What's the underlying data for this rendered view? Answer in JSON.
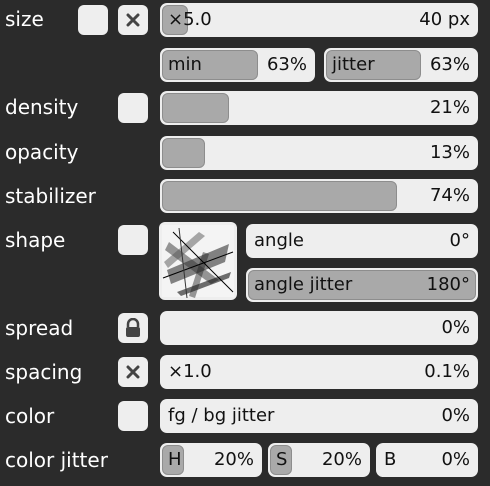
{
  "rows": {
    "size": {
      "label": "size",
      "multiplier": "×5.0",
      "value": "40 px",
      "fill_fraction": 0.07,
      "min": {
        "label": "min",
        "value": "63%",
        "fill_fraction": 0.63
      },
      "jitter": {
        "label": "jitter",
        "value": "63%",
        "fill_fraction": 0.63
      }
    },
    "density": {
      "label": "density",
      "value": "21%",
      "fill_fraction": 0.21
    },
    "opacity": {
      "label": "opacity",
      "value": "13%",
      "fill_fraction": 0.13
    },
    "stabilizer": {
      "label": "stabilizer",
      "value": "74%",
      "fill_fraction": 0.74
    },
    "shape": {
      "label": "shape",
      "angle": {
        "label": "angle",
        "value": "0°",
        "fill_fraction": 0.0
      },
      "angle_jitter": {
        "label": "angle jitter",
        "value": "180°",
        "fill_fraction": 1.0
      }
    },
    "spread": {
      "label": "spread",
      "value": "0%",
      "fill_fraction": 0.0,
      "icon": "lock-icon"
    },
    "spacing": {
      "label": "spacing",
      "multiplier": "×1.0",
      "value": "0.1%",
      "fill_fraction": 0.0,
      "icon": "close-icon"
    },
    "color": {
      "label": "color",
      "field_label": "fg / bg jitter",
      "value": "0%",
      "fill_fraction": 0.0
    },
    "color_jitter": {
      "label": "color jitter",
      "h": {
        "label": "H",
        "value": "20%",
        "fill_fraction": 0.2
      },
      "s": {
        "label": "S",
        "value": "20%",
        "fill_fraction": 0.2
      },
      "b": {
        "label": "B",
        "value": "0%",
        "fill_fraction": 0.0
      }
    }
  },
  "colors": {
    "background": "#2b2b2b",
    "control": "#eeeeee",
    "fill": "#a9a9a9"
  }
}
